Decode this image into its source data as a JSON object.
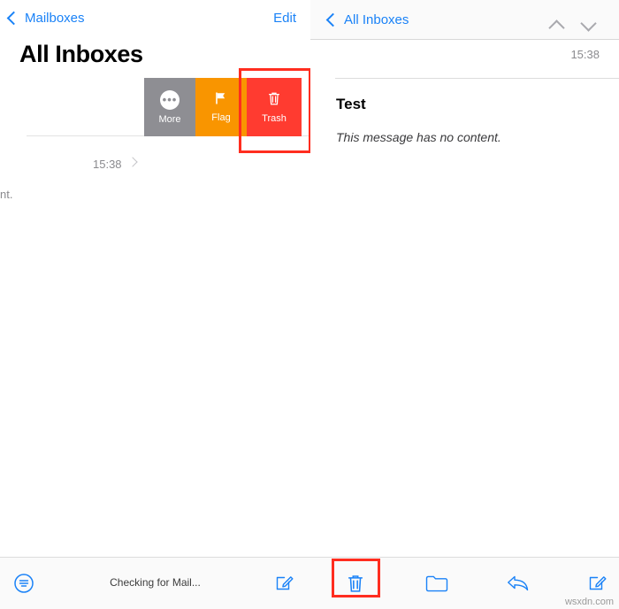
{
  "left": {
    "back_label": "Mailboxes",
    "edit_label": "Edit",
    "title": "All Inboxes",
    "row": {
      "time": "15:38",
      "snippet": "nt."
    },
    "swipe_actions": [
      {
        "label": "More",
        "icon": "ellipsis-icon",
        "color": "#8e8e93"
      },
      {
        "label": "Flag",
        "icon": "flag-icon",
        "color": "#f99500"
      },
      {
        "label": "Trash",
        "icon": "trash-icon",
        "color": "#ff3b30"
      }
    ],
    "toolbar": {
      "filter_icon": "filter-icon",
      "status": "Checking for Mail...",
      "compose_icon": "compose-icon"
    }
  },
  "right": {
    "back_label": "All Inboxes",
    "up_icon": "chevron-up-icon",
    "down_icon": "chevron-down-icon",
    "time": "15:38",
    "subject": "Test",
    "body": "This message has no content.",
    "toolbar": [
      {
        "icon": "trash-icon",
        "name": "delete-button"
      },
      {
        "icon": "folder-icon",
        "name": "move-button"
      },
      {
        "icon": "reply-icon",
        "name": "reply-button"
      },
      {
        "icon": "compose-icon",
        "name": "compose-button"
      }
    ]
  },
  "annotations": {
    "highlight_color": "#ff2d1f"
  },
  "watermark": "wsxdn.com"
}
